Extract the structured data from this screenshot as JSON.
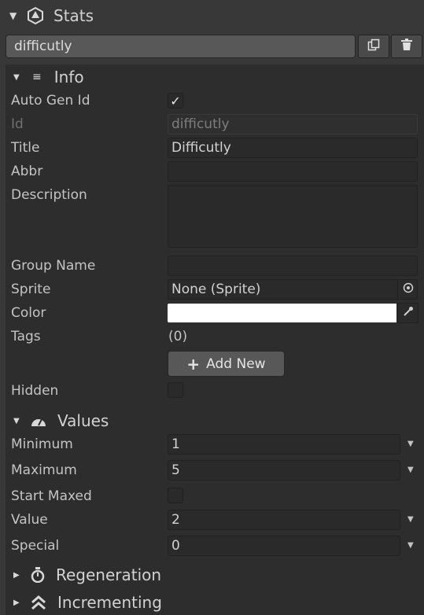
{
  "header": {
    "title": "Stats",
    "icon": "d20-dice-icon"
  },
  "selector": {
    "value": "difficutly",
    "copy_icon": "copy-icon",
    "delete_icon": "trash-icon"
  },
  "info": {
    "title": "Info",
    "auto_gen_id": {
      "label": "Auto Gen Id",
      "checked": true,
      "mark": "✓"
    },
    "id": {
      "label": "Id",
      "value": "difficutly"
    },
    "title_field": {
      "label": "Title",
      "value": "Difficutly"
    },
    "abbr": {
      "label": "Abbr",
      "value": ""
    },
    "description": {
      "label": "Description",
      "value": ""
    },
    "group_name": {
      "label": "Group Name",
      "value": ""
    },
    "sprite": {
      "label": "Sprite",
      "value": "None (Sprite)"
    },
    "color": {
      "label": "Color",
      "value": "#ffffff"
    },
    "tags": {
      "label": "Tags",
      "count": "(0)"
    },
    "add_new": {
      "label": "Add New"
    },
    "hidden": {
      "label": "Hidden",
      "checked": false
    }
  },
  "values": {
    "title": "Values",
    "minimum": {
      "label": "Minimum",
      "value": "1"
    },
    "maximum": {
      "label": "Maximum",
      "value": "5"
    },
    "start_maxed": {
      "label": "Start Maxed",
      "checked": false
    },
    "value": {
      "label": "Value",
      "value": "2"
    },
    "special": {
      "label": "Special",
      "value": "0"
    }
  },
  "sections": {
    "regeneration": "Regeneration",
    "incrementing": "Incrementing"
  },
  "colors": {
    "background": "#383838",
    "panel": "#2d2d2d",
    "field": "#2a2a2a",
    "button": "#4a4a4a"
  }
}
